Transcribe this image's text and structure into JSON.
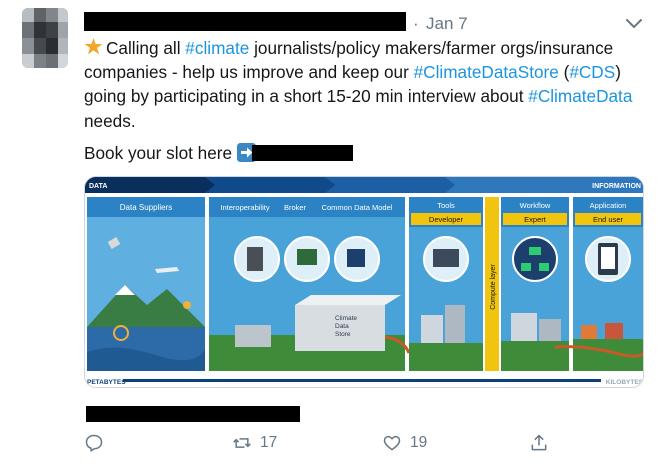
{
  "tweet": {
    "date_separator": "·",
    "date": "Jan 7",
    "body_lines": [
      {
        "segments": [
          {
            "text": "Calling all ",
            "type": "text"
          },
          {
            "text": "#climate",
            "type": "hashtag"
          },
          {
            "text": " journalists/policy makers/farmer orgs/insurance",
            "type": "text"
          }
        ]
      },
      {
        "segments": [
          {
            "text": "companies - help us improve and keep our ",
            "type": "text"
          },
          {
            "text": "#ClimateDataStore",
            "type": "hashtag"
          },
          {
            "text": " (",
            "type": "text"
          },
          {
            "text": "#CDS",
            "type": "hashtag"
          },
          {
            "text": ")",
            "type": "text"
          }
        ]
      },
      {
        "segments": [
          {
            "text": "going by participating in a short 15-20 min interview about ",
            "type": "text"
          },
          {
            "text": "#ClimateData",
            "type": "hashtag"
          }
        ]
      },
      {
        "segments": [
          {
            "text": " needs.",
            "type": "text"
          }
        ]
      }
    ],
    "book_text": "Book your slot here",
    "leading_emoji": "star-icon",
    "link_emoji": "right-arrow-icon",
    "hashtag_color": "#1b95e0"
  },
  "infographic": {
    "top_left": "DATA",
    "top_right": "INFORMATION",
    "bottom_left": "PETABYTES",
    "bottom_right": "KILOBYTES",
    "panel1_label": "Data Suppliers",
    "panel2_labels": [
      "Interoperability",
      "Broker",
      "Common Data Model"
    ],
    "store_label": [
      "Climate",
      "Data",
      "Store"
    ],
    "tools_label": "Tools",
    "developer_label": "Developer",
    "compute_label": "Compute layer",
    "workflow_label": "Workflow",
    "expert_label": "Expert",
    "application_label": "Application",
    "enduser_label": "End user"
  },
  "actions": {
    "reply_count": "",
    "retweet_count": "17",
    "like_count": "19"
  }
}
